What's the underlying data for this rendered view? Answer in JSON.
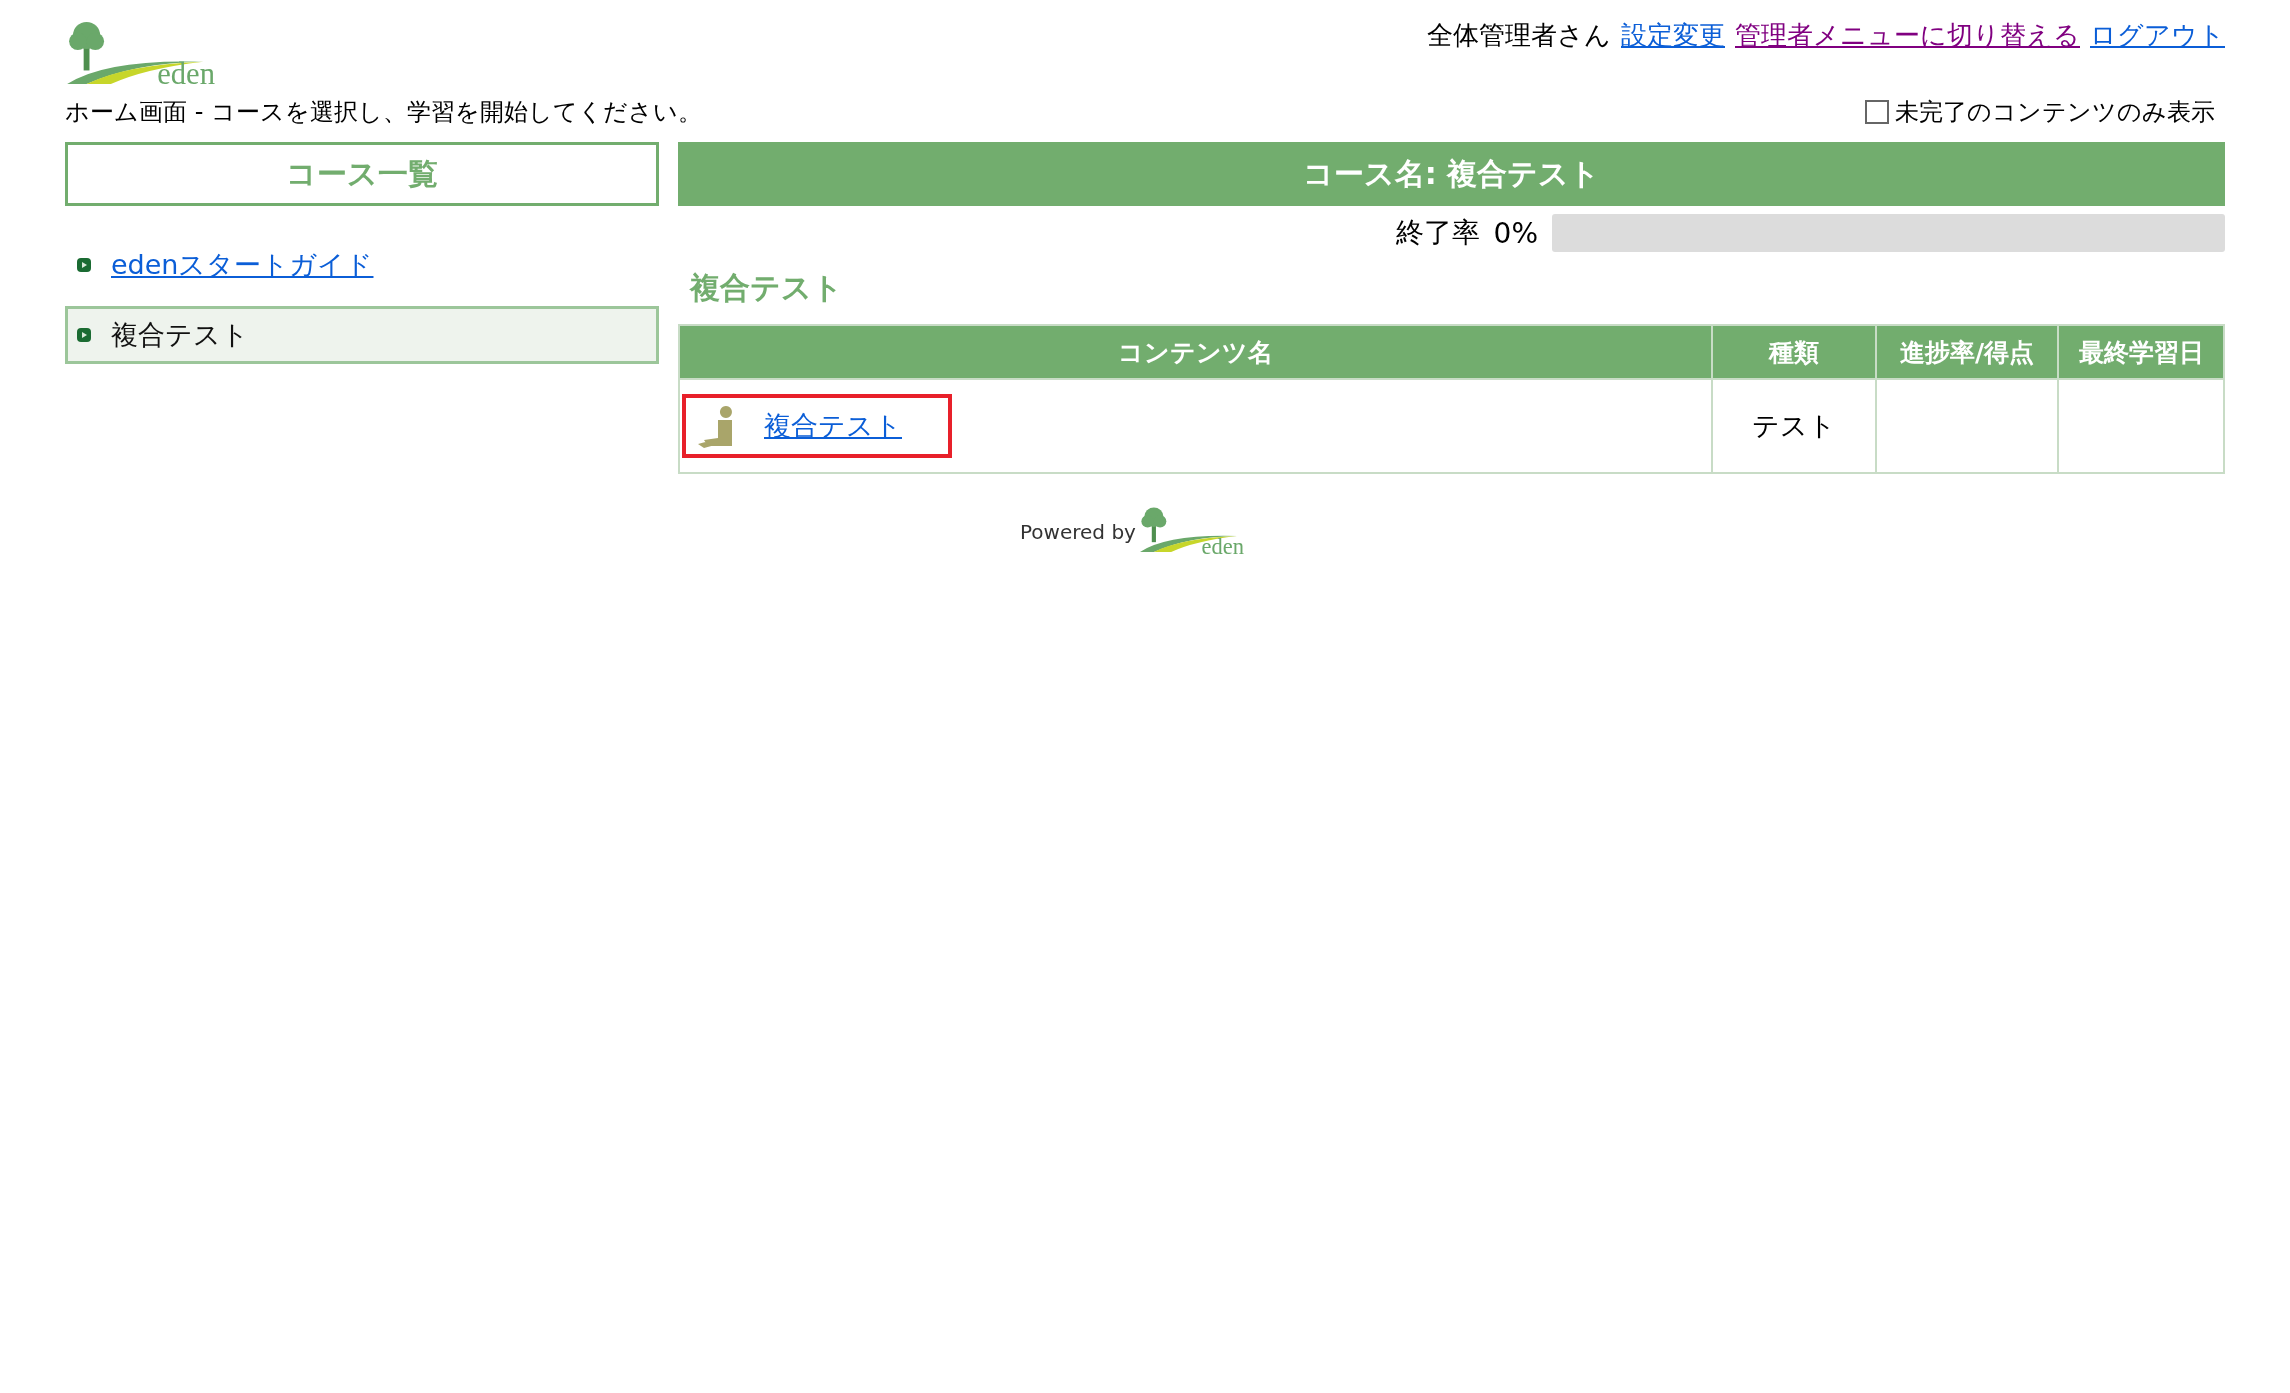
{
  "logo": {
    "text": "eden"
  },
  "header": {
    "greeting": "全体管理者さん",
    "links": [
      {
        "label": "設定変更",
        "visited": false
      },
      {
        "label": "管理者メニューに切り替える",
        "visited": true
      },
      {
        "label": "ログアウト",
        "visited": false
      }
    ]
  },
  "breadcrumb": "ホーム画面 - コースを選択し、学習を開始してください。",
  "filter": {
    "label": "未完了のコンテンツのみ表示",
    "checked": false
  },
  "sidebar": {
    "title": "コース一覧",
    "items": [
      {
        "label": "edenスタートガイド",
        "selected": false
      },
      {
        "label": "複合テスト",
        "selected": true
      }
    ]
  },
  "course": {
    "title": "コース名: 複合テスト",
    "progress_label": "終了率",
    "progress_value": "0%",
    "level": 0,
    "section_title": "複合テスト"
  },
  "table": {
    "columns": [
      "コンテンツ名",
      "種類",
      "進捗率/得点",
      "最終学習日"
    ],
    "rows": [
      {
        "name": "複合テスト",
        "type": "テスト",
        "focused": true
      }
    ]
  },
  "footer": {
    "powered_by": "Powered by",
    "logo_text": "eden"
  }
}
